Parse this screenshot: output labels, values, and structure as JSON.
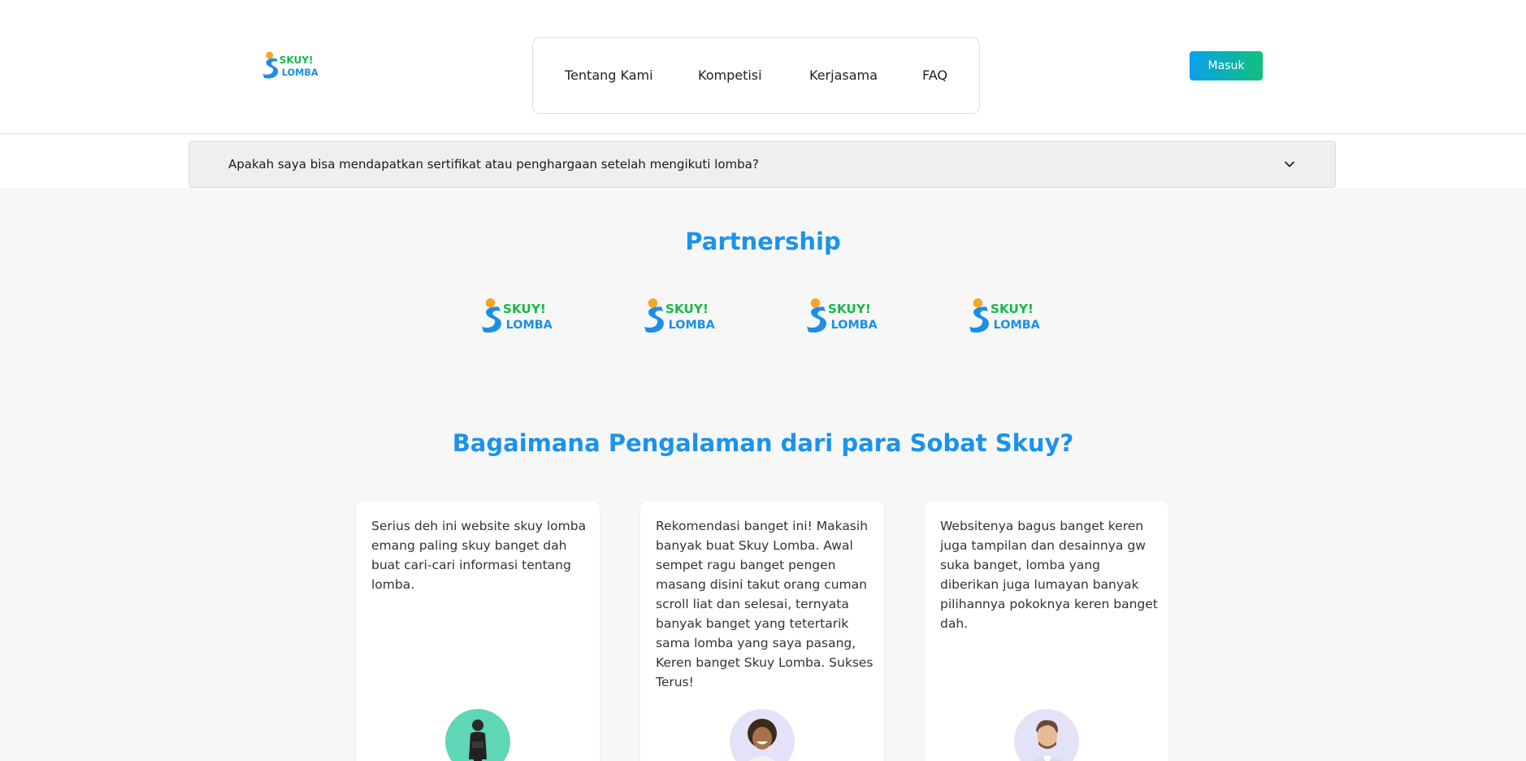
{
  "brand": {
    "logo_line1": "SKUY!",
    "logo_line2": "LOMBA",
    "colors": {
      "green": "#16b94a",
      "blue": "#1b8fe6",
      "orange": "#f5a623"
    }
  },
  "nav": {
    "items": [
      {
        "label": "Tentang Kami"
      },
      {
        "label": "Kompetisi"
      },
      {
        "label": "Kerjasama"
      },
      {
        "label": "FAQ"
      }
    ],
    "login_label": "Masuk"
  },
  "faq": {
    "question": "Apakah saya bisa mendapatkan sertifikat atau penghargaan setelah mengikuti lomba?",
    "icon": "chevron-down-icon"
  },
  "partnership": {
    "title": "Partnership",
    "logo_count": 4
  },
  "testimonials": {
    "title": "Bagaimana Pengalaman dari para Sobat Skuy?",
    "items": [
      {
        "text": "Serius deh ini website skuy lomba emang paling skuy banget dah buat cari-cari informasi tentang lomba.",
        "avatar_bg": "#5fd6b6"
      },
      {
        "text": "Rekomendasi banget ini! Makasih banyak buat Skuy Lomba. Awal sempet ragu banget pengen masang disini takut orang cuman scroll liat dan selesai, ternyata banyak banget yang tetertarik sama lomba yang saya pasang, Keren banget Skuy Lomba. Sukses Terus!",
        "avatar_bg": "#e4e2f8"
      },
      {
        "text": "Websitenya bagus banget keren juga tampilan dan desainnya gw suka banget, lomba yang diberikan juga lumayan banyak pilihannya pokoknya keren banget dah.",
        "avatar_bg": "#e4e2f8"
      }
    ]
  }
}
